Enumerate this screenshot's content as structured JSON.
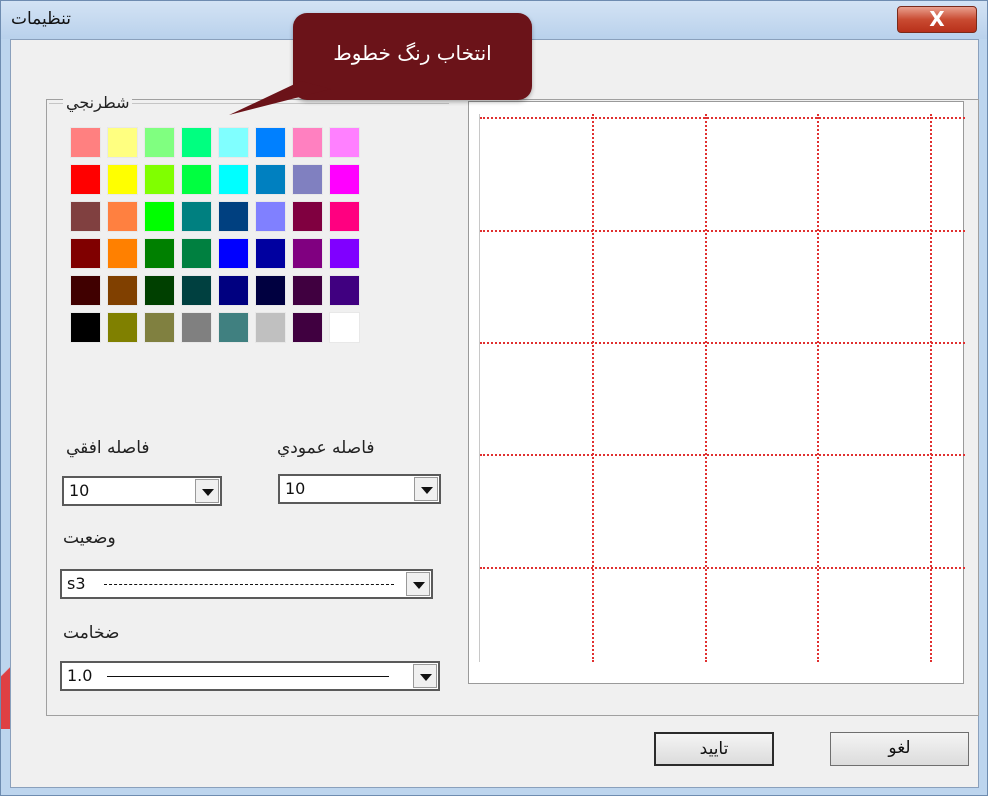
{
  "window": {
    "title": "تنظیمات",
    "close_label": "X"
  },
  "callout": {
    "text": "انتخاب رنگ خطوط"
  },
  "color_group": {
    "label": "شطرنجي",
    "swatches": [
      [
        "#ff8080",
        "#ffff80",
        "#80ff80",
        "#00ff80",
        "#80ffff",
        "#0080ff",
        "#ff80c0",
        "#ff80ff"
      ],
      [
        "#ff0000",
        "#ffff00",
        "#80ff00",
        "#00ff40",
        "#00ffff",
        "#0080c0",
        "#8080c0",
        "#ff00ff"
      ],
      [
        "#804040",
        "#ff8040",
        "#00ff00",
        "#008080",
        "#004080",
        "#8080ff",
        "#800040",
        "#ff0080"
      ],
      [
        "#800000",
        "#ff8000",
        "#008000",
        "#008040",
        "#0000ff",
        "#0000a0",
        "#800080",
        "#8000ff"
      ],
      [
        "#400000",
        "#804000",
        "#004000",
        "#004040",
        "#000080",
        "#000040",
        "#400040",
        "#400080"
      ],
      [
        "#000000",
        "#808000",
        "#808040",
        "#808080",
        "#408080",
        "#c0c0c0",
        "#400040",
        "#ffffff"
      ]
    ]
  },
  "spacing": {
    "horizontal_label": "فاصله افقي",
    "horizontal_value": "10",
    "vertical_label": "فاصله عمودي",
    "vertical_value": "10"
  },
  "status": {
    "label": "وضعيت",
    "value": "s3"
  },
  "thickness": {
    "label": "ضخامت",
    "value": "1.0"
  },
  "buttons": {
    "cancel": "لغو",
    "confirm": "تایید"
  },
  "preview": {
    "grid_color": "#e03030"
  }
}
